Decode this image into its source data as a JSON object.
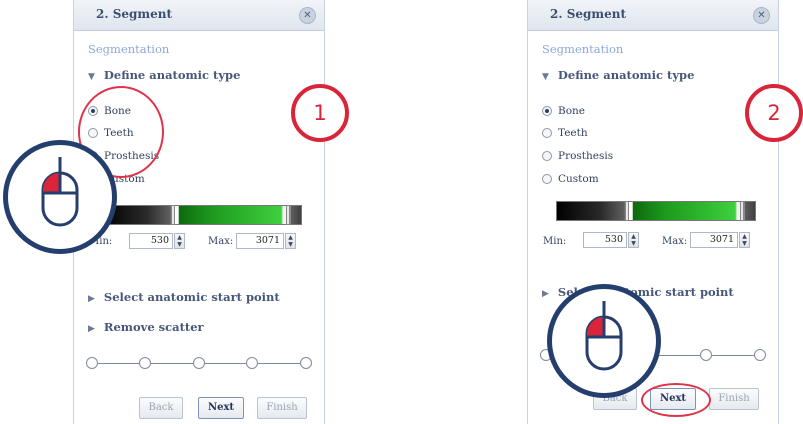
{
  "steps": [
    "1",
    "2"
  ],
  "panel": {
    "title": "2. Segment",
    "close_icon": "x-circle-icon",
    "section_label": "Segmentation",
    "define_type": "Define anatomic type",
    "options": [
      "Bone",
      "Teeth",
      "Prosthesis",
      "Custom"
    ],
    "selected_option": "Bone",
    "min_label": "Min:",
    "min_value": "530",
    "max_label": "Max:",
    "max_value": "3071",
    "start_point": "Select anatomic start point",
    "remove_scatter": "Remove scatter",
    "buttons": {
      "back": "Back",
      "next": "Next",
      "finish": "Finish"
    },
    "slider_steps": 5,
    "slider_position": 1
  },
  "colors": {
    "accent_red": "#d8253a",
    "navy": "#243f6d",
    "link_blue": "#8fa7d5"
  }
}
